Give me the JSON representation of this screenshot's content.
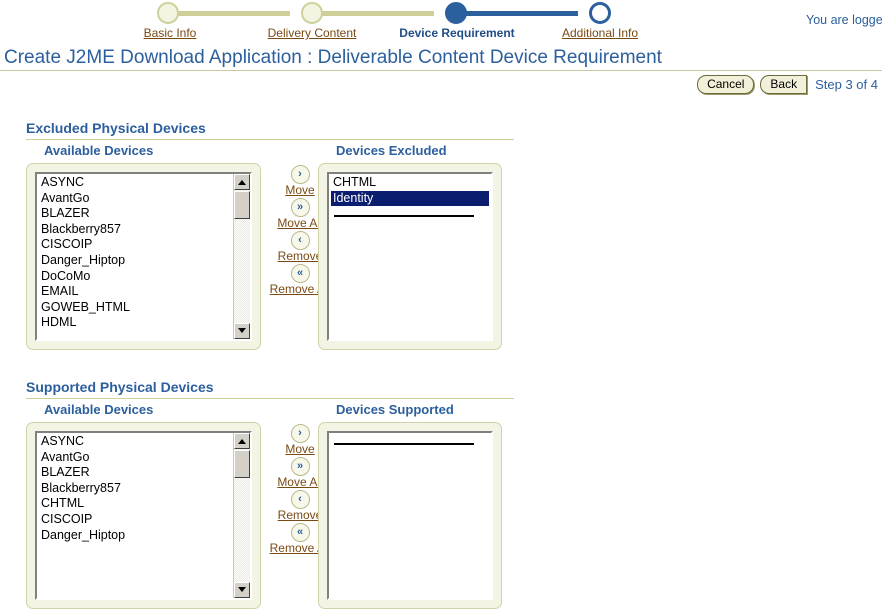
{
  "header": {
    "logged_in_text": "You are logge",
    "page_title": "Create J2ME Download Application : Deliverable Content Device Requirement",
    "step_count": "Step 3 of 4",
    "cancel_label": "Cancel",
    "back_label": "Back"
  },
  "train": {
    "steps": [
      {
        "label": "Basic Info",
        "state": "done"
      },
      {
        "label": "Delivery Content",
        "state": "done"
      },
      {
        "label": "Device Requirement",
        "state": "current"
      },
      {
        "label": "Additional Info",
        "state": "future"
      }
    ]
  },
  "transfer": {
    "move": {
      "icon": "›",
      "label": "Move"
    },
    "move_all": {
      "icon": "»",
      "label": "Move All"
    },
    "remove": {
      "icon": "‹",
      "label": "Remove"
    },
    "remove_all": {
      "icon": "«",
      "label": "Remove All"
    }
  },
  "excluded_section": {
    "title": "Excluded Physical Devices",
    "available_header": "Available Devices",
    "target_header": "Devices Excluded",
    "available_items": [
      "ASYNC",
      "AvantGo",
      "BLAZER",
      "Blackberry857",
      "CISCOIP",
      "Danger_Hiptop",
      "DoCoMo",
      "EMAIL",
      "GOWEB_HTML",
      "HDML"
    ],
    "target_items": [
      {
        "label": "CHTML",
        "selected": false
      },
      {
        "label": "Identity",
        "selected": true
      }
    ]
  },
  "supported_section": {
    "title": "Supported Physical Devices",
    "available_header": "Available Devices",
    "target_header": "Devices Supported",
    "available_items": [
      "ASYNC",
      "AvantGo",
      "BLAZER",
      "Blackberry857",
      "CHTML",
      "CISCOIP",
      "Danger_Hiptop"
    ],
    "target_items": []
  },
  "colors": {
    "accent_blue": "#2c5f9e",
    "link_brown": "#7a4a14",
    "panel_cream": "#f4f4e4",
    "panel_border": "#d2d2a8",
    "selection_navy": "#0a1d6e",
    "rule_khaki": "#cfcf9a"
  }
}
